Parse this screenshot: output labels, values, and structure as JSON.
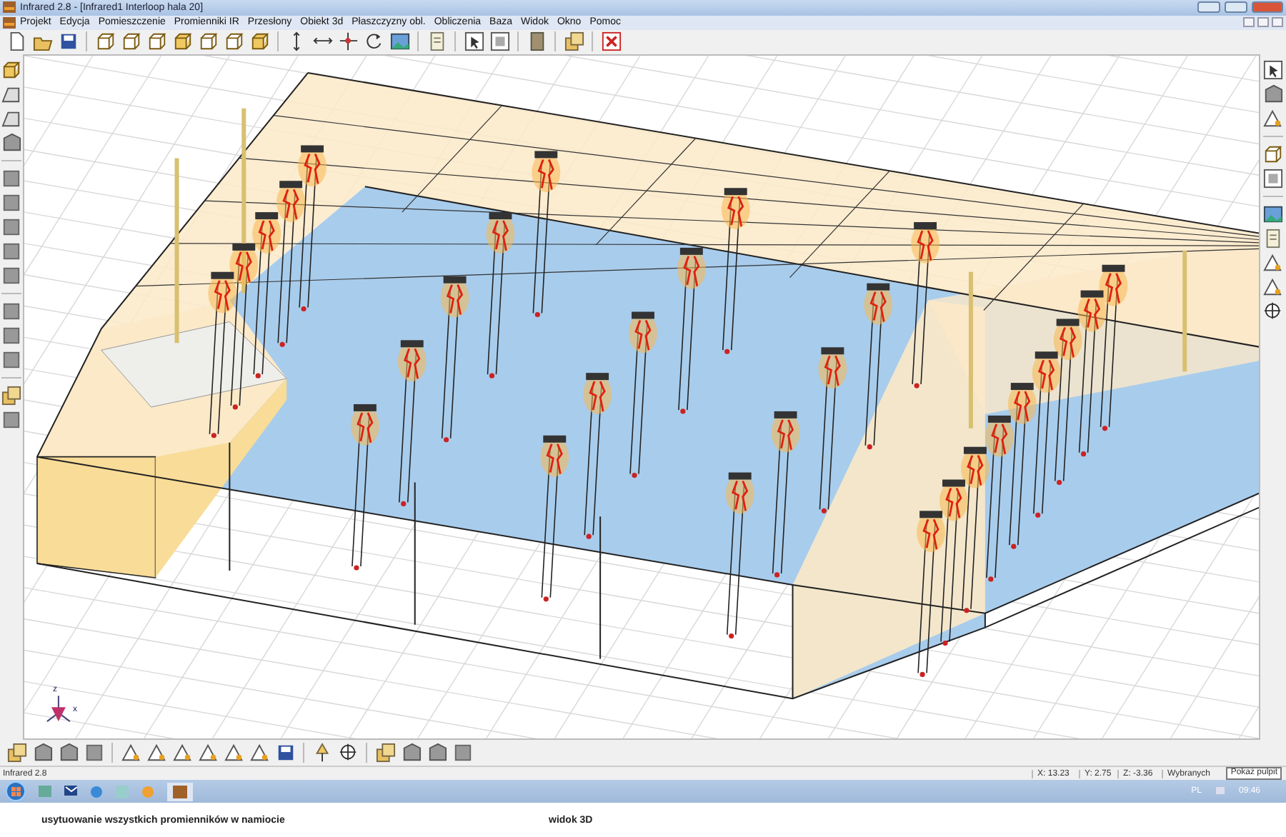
{
  "window": {
    "title": "Infrared 2.8 - [Infrared1 Interloop hala 20]"
  },
  "menu": [
    "Projekt",
    "Edycja",
    "Pomieszczenie",
    "Promienniki IR",
    "Przesłony",
    "Obiekt 3d",
    "Płaszczyzny obl.",
    "Obliczenia",
    "Baza",
    "Widok",
    "Okno",
    "Pomoc"
  ],
  "view": {
    "axis_labels": [
      "z",
      "x"
    ]
  },
  "status_bar": {
    "app": "Infrared 2.8",
    "fields": [
      "X: 13.23",
      "Y: 2.75",
      "Z: -3.36",
      "Wybranych"
    ]
  },
  "taskbar": {
    "language": "PL",
    "clock": "09:46",
    "tooltip": "Pokaż pulpit"
  },
  "captions": [
    "usytuowanie wszystkich promienników w namiocie",
    "widok 3D"
  ]
}
